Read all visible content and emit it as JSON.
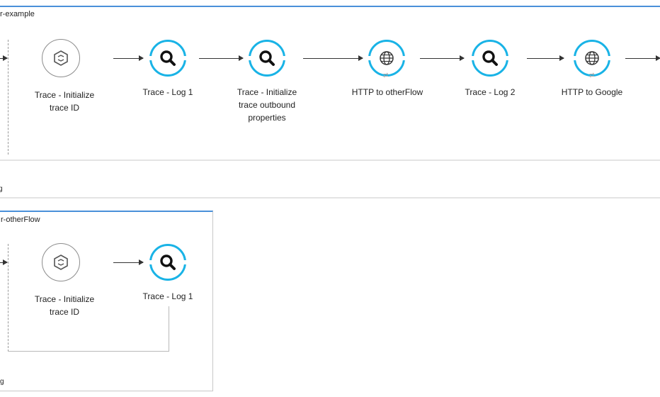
{
  "flow1": {
    "title": "r-example",
    "error_label": "g",
    "nodes": [
      {
        "label_line1": "Trace - Initialize",
        "label_line2": "trace ID",
        "label_line3": "",
        "icon": "transform-icon",
        "type": "grey"
      },
      {
        "label_line1": "Trace - Log 1",
        "label_line2": "",
        "label_line3": "",
        "icon": "search-icon",
        "type": "blue"
      },
      {
        "label_line1": "Trace - Initialize",
        "label_line2": "trace outbound",
        "label_line3": "properties",
        "icon": "search-icon",
        "type": "blue"
      },
      {
        "label_line1": "HTTP to otherFlow",
        "label_line2": "",
        "label_line3": "",
        "icon": "globe-icon",
        "type": "blue"
      },
      {
        "label_line1": "Trace - Log 2",
        "label_line2": "",
        "label_line3": "",
        "icon": "search-icon",
        "type": "blue"
      },
      {
        "label_line1": "HTTP to Google",
        "label_line2": "",
        "label_line3": "",
        "icon": "globe-icon",
        "type": "blue"
      }
    ]
  },
  "flow2": {
    "title": "r-otherFlow",
    "error_label": "g",
    "nodes": [
      {
        "label_line1": "Trace - Initialize",
        "label_line2": "trace ID",
        "icon": "transform-icon",
        "type": "grey"
      },
      {
        "label_line1": "Trace - Log 1",
        "label_line2": "",
        "icon": "search-icon",
        "type": "blue"
      }
    ]
  },
  "colors": {
    "accent": "#19b3e6",
    "flow_border": "#4a90d9",
    "node_grey": "#8d8d8d"
  }
}
